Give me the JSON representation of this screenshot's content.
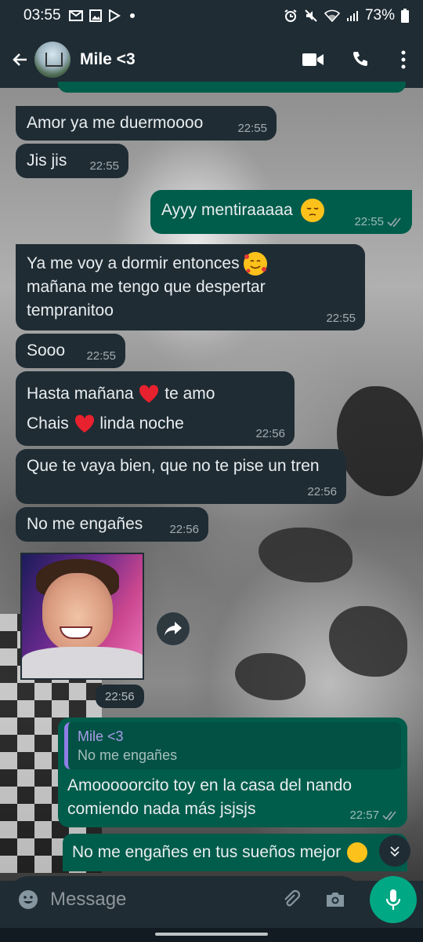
{
  "status_bar": {
    "time": "03:55",
    "battery": "73%",
    "left_icons": [
      "gmail-icon",
      "gallery-icon",
      "play-store-icon",
      "dot-icon"
    ],
    "right_icons": [
      "alarm-icon",
      "mute-icon",
      "wifi-icon",
      "signal-icon",
      "battery-icon"
    ]
  },
  "header": {
    "contact_name": "Mile <3",
    "icons": [
      "back-arrow-icon",
      "video-call-icon",
      "voice-call-icon",
      "more-vert-icon"
    ]
  },
  "messages": [
    {
      "direction": "in",
      "text": "Amor ya me duermoooo",
      "time": "22:55"
    },
    {
      "direction": "in",
      "text": "Jis jis",
      "time": "22:55"
    },
    {
      "direction": "out",
      "text": "Ayyy mentiraaaaa",
      "emoji": "pensive-face",
      "time": "22:55",
      "status": "read"
    },
    {
      "direction": "in",
      "line1": "Ya me voy a dormir entonces",
      "line2": "mañana me tengo que despertar",
      "line3": "tempranitoo",
      "emoji": "smiling-face-with-hearts",
      "time": "22:55"
    },
    {
      "direction": "in",
      "text": "Sooo",
      "time": "22:55"
    },
    {
      "direction": "in",
      "line1a": "Hasta mañana",
      "line1b": "te amo",
      "line2a": "Chais",
      "line2b": "linda noche",
      "emoji": "red-heart",
      "time": "22:56"
    },
    {
      "direction": "in",
      "text": "Que te vaya bien, que no te pise un tren",
      "time": "22:56"
    },
    {
      "direction": "in",
      "text": "No me engañes",
      "time": "22:56"
    },
    {
      "direction": "in",
      "type": "image",
      "time": "22:56"
    },
    {
      "direction": "out",
      "quote_name": "Mile <3",
      "quote_text": "No me engañes",
      "line1": "Amooooorcito toy en la casa del nando",
      "line2": "comiendo nada más jsjsjs",
      "time": "22:57",
      "status": "read"
    },
    {
      "direction": "out",
      "text": "No me engañes en tus sueños mejor",
      "emoji": "face-partial"
    }
  ],
  "input": {
    "placeholder": "Message"
  },
  "colors": {
    "header_bg": "#1f2c34",
    "incoming_bubble": "#1f2c34",
    "outgoing_bubble": "#005c4b",
    "accent": "#00a884",
    "quote_bar": "#8e7ee6"
  }
}
